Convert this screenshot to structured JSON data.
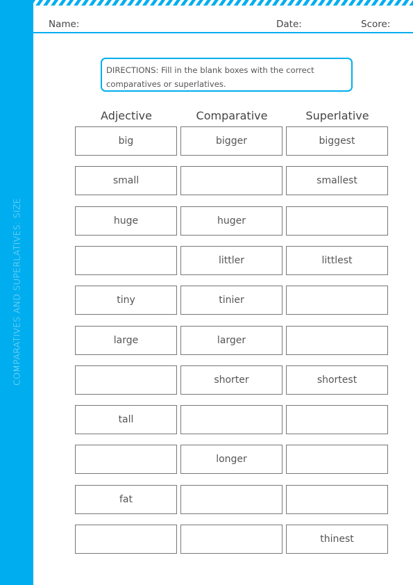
{
  "sidebar": {
    "title": "COMPARATIVES AND SUPERLATIVES: SIZE"
  },
  "header": {
    "name_label": "Name:",
    "date_label": "Date:",
    "score_label": "Score:"
  },
  "directions": {
    "text": "DIRECTIONS: Fill in the blank boxes with the correct comparatives or superlatives."
  },
  "colors": {
    "accent": "#00AEEF",
    "box_border": "#777777",
    "text": "#555555"
  },
  "table": {
    "headers": [
      "Adjective",
      "Comparative",
      "Superlative"
    ],
    "rows": [
      [
        "big",
        "bigger",
        "biggest"
      ],
      [
        "small",
        "",
        "smallest"
      ],
      [
        "huge",
        "huger",
        ""
      ],
      [
        "",
        "littler",
        "littlest"
      ],
      [
        "tiny",
        "tinier",
        ""
      ],
      [
        "large",
        "larger",
        ""
      ],
      [
        "",
        "shorter",
        "shortest"
      ],
      [
        "tall",
        "",
        ""
      ],
      [
        "",
        "longer",
        ""
      ],
      [
        "fat",
        "",
        ""
      ],
      [
        "",
        "",
        "thinest"
      ]
    ]
  }
}
